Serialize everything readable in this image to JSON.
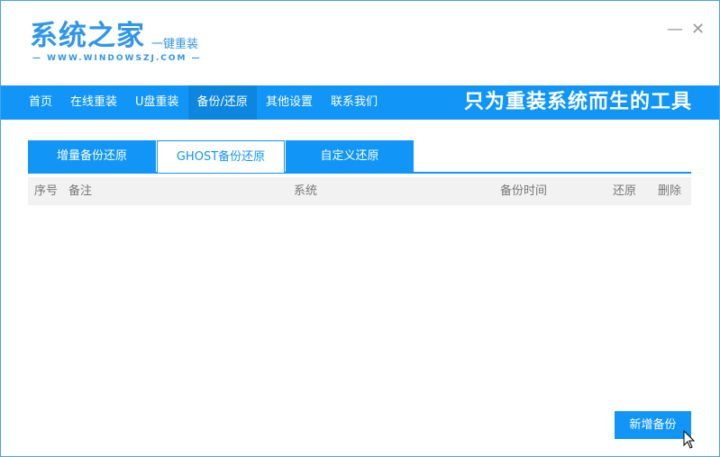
{
  "logo": {
    "title": "系统之家",
    "subtitle": "一键重装",
    "url": "—  WWW.WINDOWSZJ.COM  —"
  },
  "window": {
    "minimize": "—",
    "close": "✕"
  },
  "nav": {
    "items": [
      "首页",
      "在线重装",
      "U盘重装",
      "备份/还原",
      "其他设置",
      "联系我们"
    ],
    "active": 3,
    "slogan": "只为重装系统而生的工具"
  },
  "tabs": {
    "items": [
      "增量备份还原",
      "GHOST备份还原",
      "自定义还原"
    ],
    "active": 1
  },
  "table": {
    "columns": [
      "序号",
      "备注",
      "系统",
      "备份时间",
      "还原",
      "删除"
    ],
    "rows": []
  },
  "actions": {
    "new_backup": "新增备份"
  },
  "colors": {
    "accent": "#1196f7",
    "nav_active": "#0c86df",
    "header_bg": "#f2f2f2"
  }
}
